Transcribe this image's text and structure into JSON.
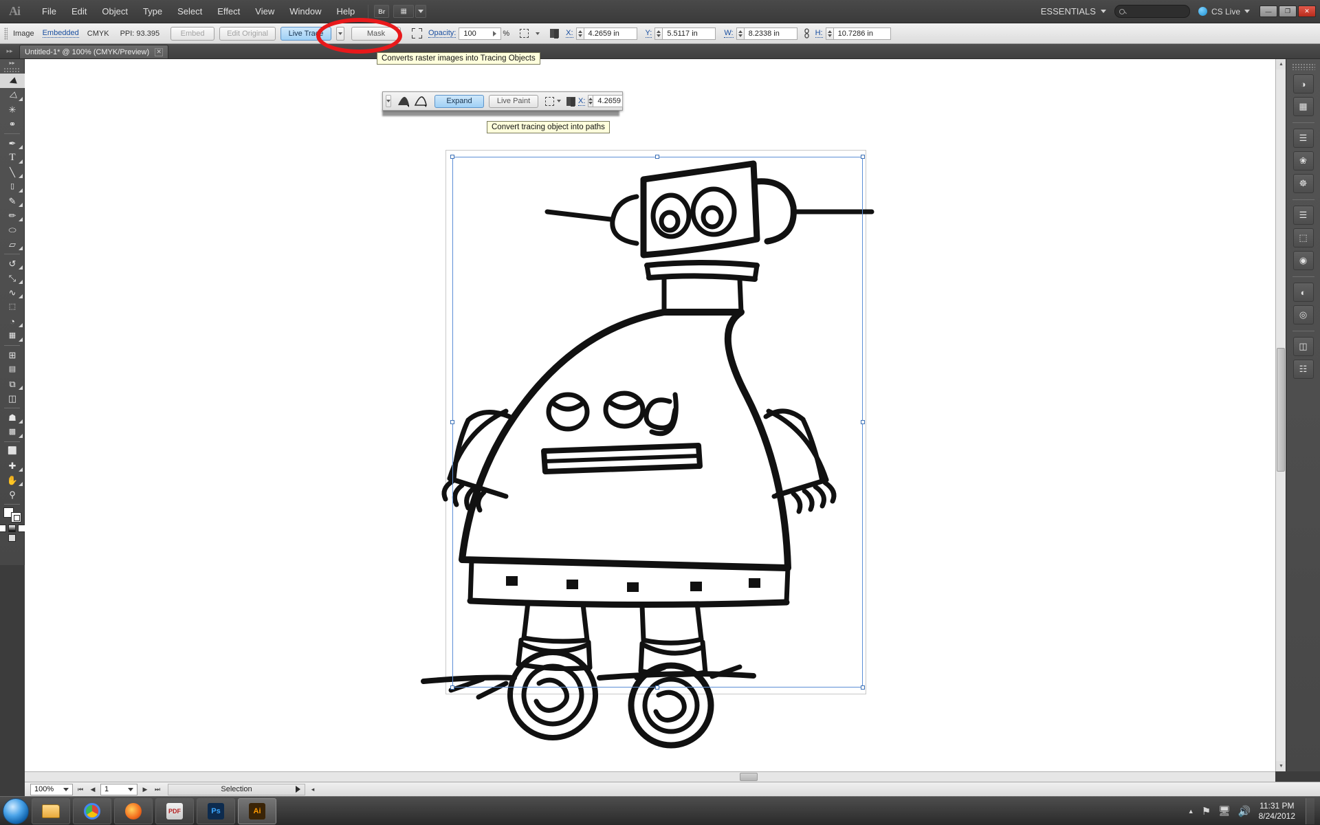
{
  "app": {
    "name": "Adobe Illustrator",
    "logo": "Ai",
    "workspace": "ESSENTIALS",
    "cs_live": "CS Live"
  },
  "menubar": {
    "items": [
      "File",
      "Edit",
      "Object",
      "Type",
      "Select",
      "Effect",
      "View",
      "Window",
      "Help"
    ],
    "bridge_button": "Br",
    "search_placeholder": ""
  },
  "window_controls": {
    "minimize": "—",
    "restore": "❐",
    "close": "✕"
  },
  "control_bar": {
    "object_label": "Image",
    "embedded_link": "Embedded",
    "color_mode": "CMYK",
    "ppi": "PPI: 93.395",
    "embed_button": "Embed",
    "edit_original_button": "Edit Original",
    "live_trace_button": "Live Trace",
    "mask_button": "Mask",
    "opacity_label": "Opacity:",
    "opacity_value": "100",
    "percent_sign": "%",
    "x_label": "X:",
    "x_value": "4.2659 in",
    "y_label": "Y:",
    "y_value": "5.5117 in",
    "w_label": "W:",
    "w_value": "8.2338 in",
    "h_label": "H:",
    "h_value": "10.7286 in"
  },
  "tooltips": {
    "live_trace": "Converts raster images into Tracing Objects",
    "expand": "Convert tracing object into paths"
  },
  "tracing_strip": {
    "expand_button": "Expand",
    "live_paint_button": "Live Paint",
    "x_label": "X:",
    "x_value": "4.2659"
  },
  "document_tab": {
    "title": "Untitled-1* @ 100% (CMYK/Preview)",
    "close": "✕"
  },
  "tools": [
    {
      "name": "selection-tool",
      "glyph": "▶"
    },
    {
      "name": "direct-selection-tool",
      "glyph": "▷"
    },
    {
      "name": "magic-wand-tool",
      "glyph": "✳"
    },
    {
      "name": "lasso-tool",
      "glyph": "☁"
    },
    {
      "name": "pen-tool",
      "glyph": "✒"
    },
    {
      "name": "type-tool",
      "glyph": "T"
    },
    {
      "name": "line-segment-tool",
      "glyph": "╲"
    },
    {
      "name": "rectangle-tool",
      "glyph": "■"
    },
    {
      "name": "paintbrush-tool",
      "glyph": "✎"
    },
    {
      "name": "pencil-tool",
      "glyph": "✏"
    },
    {
      "name": "blob-brush-tool",
      "glyph": "⬭"
    },
    {
      "name": "eraser-tool",
      "glyph": "▱"
    },
    {
      "name": "rotate-tool",
      "glyph": "↺"
    },
    {
      "name": "scale-tool",
      "glyph": "⤡"
    },
    {
      "name": "width-tool",
      "glyph": "∿"
    },
    {
      "name": "free-transform-tool",
      "glyph": "⬚"
    },
    {
      "name": "symbol-sprayer-tool",
      "glyph": "◔"
    },
    {
      "name": "column-graph-tool",
      "glyph": "█"
    },
    {
      "name": "mesh-tool",
      "glyph": "⊞"
    },
    {
      "name": "gradient-tool",
      "glyph": "▤"
    },
    {
      "name": "eyedropper-tool",
      "glyph": "⚗"
    },
    {
      "name": "blend-tool",
      "glyph": "◫"
    },
    {
      "name": "live-paint-bucket-tool",
      "glyph": "☗"
    },
    {
      "name": "graph-tool",
      "glyph": "ᴵ"
    },
    {
      "name": "artboard-tool",
      "glyph": "⬜"
    },
    {
      "name": "slice-tool",
      "glyph": "✄"
    },
    {
      "name": "hand-tool",
      "glyph": "✋"
    },
    {
      "name": "zoom-tool",
      "glyph": "⚲"
    }
  ],
  "right_dock": [
    {
      "name": "color-panel-icon",
      "glyph": "◑"
    },
    {
      "name": "color-guide-panel-icon",
      "glyph": "▦"
    },
    {
      "name": "appearance-panel-icon",
      "glyph": "◎"
    },
    {
      "name": "graphic-styles-panel-icon",
      "glyph": "◉"
    },
    {
      "name": "symbols-panel-icon",
      "glyph": "❀"
    },
    {
      "name": "brushes-panel-icon",
      "glyph": "✒"
    },
    {
      "name": "stroke-panel-icon",
      "glyph": "≡"
    },
    {
      "name": "gradient-panel-icon",
      "glyph": "▤"
    },
    {
      "name": "transparency-panel-icon",
      "glyph": "◐"
    },
    {
      "name": "align-panel-icon",
      "glyph": "⌸"
    },
    {
      "name": "pathfinder-panel-icon",
      "glyph": "◓"
    },
    {
      "name": "transform-panel-icon",
      "glyph": "⧉"
    },
    {
      "name": "layers-panel-icon",
      "glyph": "☰"
    },
    {
      "name": "artboards-panel-icon",
      "glyph": "◳"
    }
  ],
  "status_bar": {
    "zoom_level": "100%",
    "page_number": "1",
    "status_text": "Selection",
    "first_page": "⏮",
    "prev_page": "◀",
    "next_page": "▶",
    "last_page": "⏭"
  },
  "taskbar": {
    "items": [
      {
        "name": "windows-explorer-taskbar-icon",
        "glyph": "folder"
      },
      {
        "name": "google-chrome-taskbar-icon",
        "glyph": "chrome"
      },
      {
        "name": "firefox-taskbar-icon",
        "glyph": "firefox"
      },
      {
        "name": "pdf-reader-taskbar-icon",
        "glyph": "PDF"
      },
      {
        "name": "photoshop-taskbar-icon",
        "glyph": "Ps"
      },
      {
        "name": "illustrator-taskbar-icon",
        "glyph": "Ai"
      }
    ],
    "tray": {
      "show_hidden": "▲",
      "network_flag": "⚑",
      "network": "⬚",
      "volume": "ᴰ",
      "time": "11:31 PM",
      "date": "8/24/2012"
    }
  },
  "canvas": {
    "artwork_description": "hand-drawn robot on wheels line drawing",
    "selection_color": "#5b8ed6"
  },
  "colors": {
    "annotation_red": "#e8191b",
    "accent_blue": "#9fd0f5",
    "link_blue": "#1a4fa0",
    "tooltip_bg": "#ffffdc"
  }
}
